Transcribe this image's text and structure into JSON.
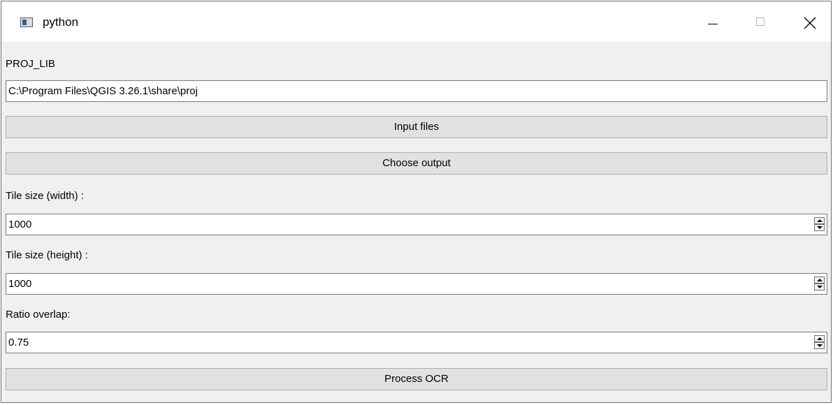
{
  "window": {
    "title": "python",
    "icons": {
      "app": "app-window-icon",
      "minimize": "minimize-icon",
      "maximize": "maximize-icon",
      "close": "close-icon"
    }
  },
  "form": {
    "proj_lib_label": "PROJ_LIB",
    "proj_lib_value": "C:\\Program Files\\QGIS 3.26.1\\share\\proj",
    "input_files_label": "Input files",
    "choose_output_label": "Choose output",
    "tile_width_label": "Tile size (width) :",
    "tile_width_value": "1000",
    "tile_height_label": "Tile size (height) :",
    "tile_height_value": "1000",
    "ratio_overlap_label": "Ratio overlap:",
    "ratio_overlap_value": "0.75",
    "process_ocr_label": "Process OCR"
  }
}
